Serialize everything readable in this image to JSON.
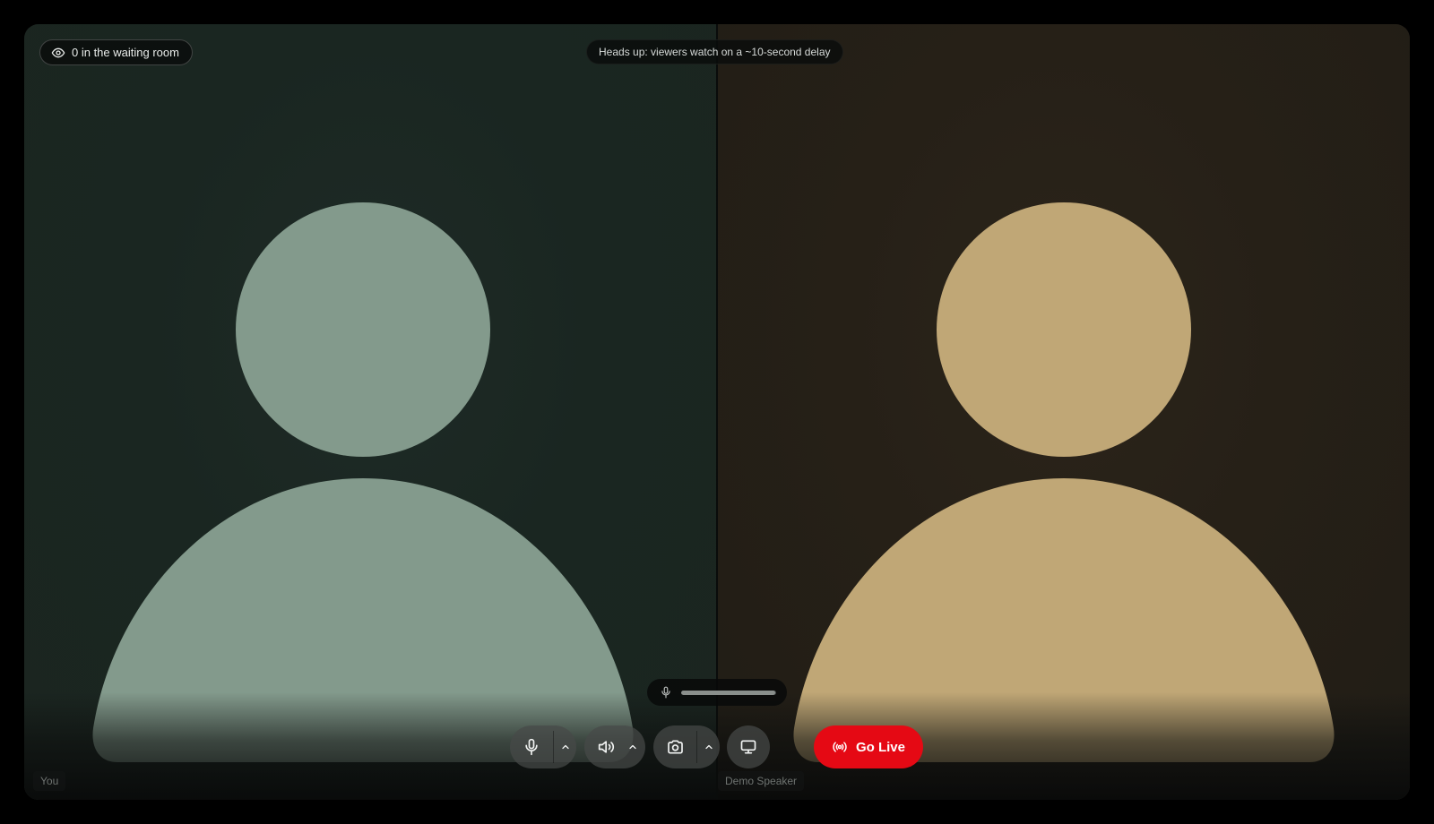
{
  "waiting_room": {
    "label": "0 in the waiting room",
    "icon": "eye-icon"
  },
  "delay_notice": {
    "text": "Heads up: viewers watch on a ~10-second delay"
  },
  "participants": [
    {
      "name": "You",
      "avatar_color": "#839a8c",
      "bg_color": "#1b2520"
    },
    {
      "name": "Demo Speaker",
      "avatar_color": "#c0a776",
      "bg_color": "#221d16"
    }
  ],
  "mic_level": {
    "icon": "microphone-icon",
    "level": 0.99
  },
  "controls": {
    "mic": {
      "icon": "microphone-icon",
      "menu_icon": "chevron-up-icon"
    },
    "speaker": {
      "icon": "speaker-icon",
      "menu_icon": "chevron-up-icon"
    },
    "camera": {
      "icon": "camera-icon",
      "menu_icon": "chevron-up-icon"
    },
    "screen_share": {
      "icon": "monitor-icon"
    },
    "go_live": {
      "label": "Go Live",
      "icon": "broadcast-icon",
      "color": "#e50914"
    }
  }
}
